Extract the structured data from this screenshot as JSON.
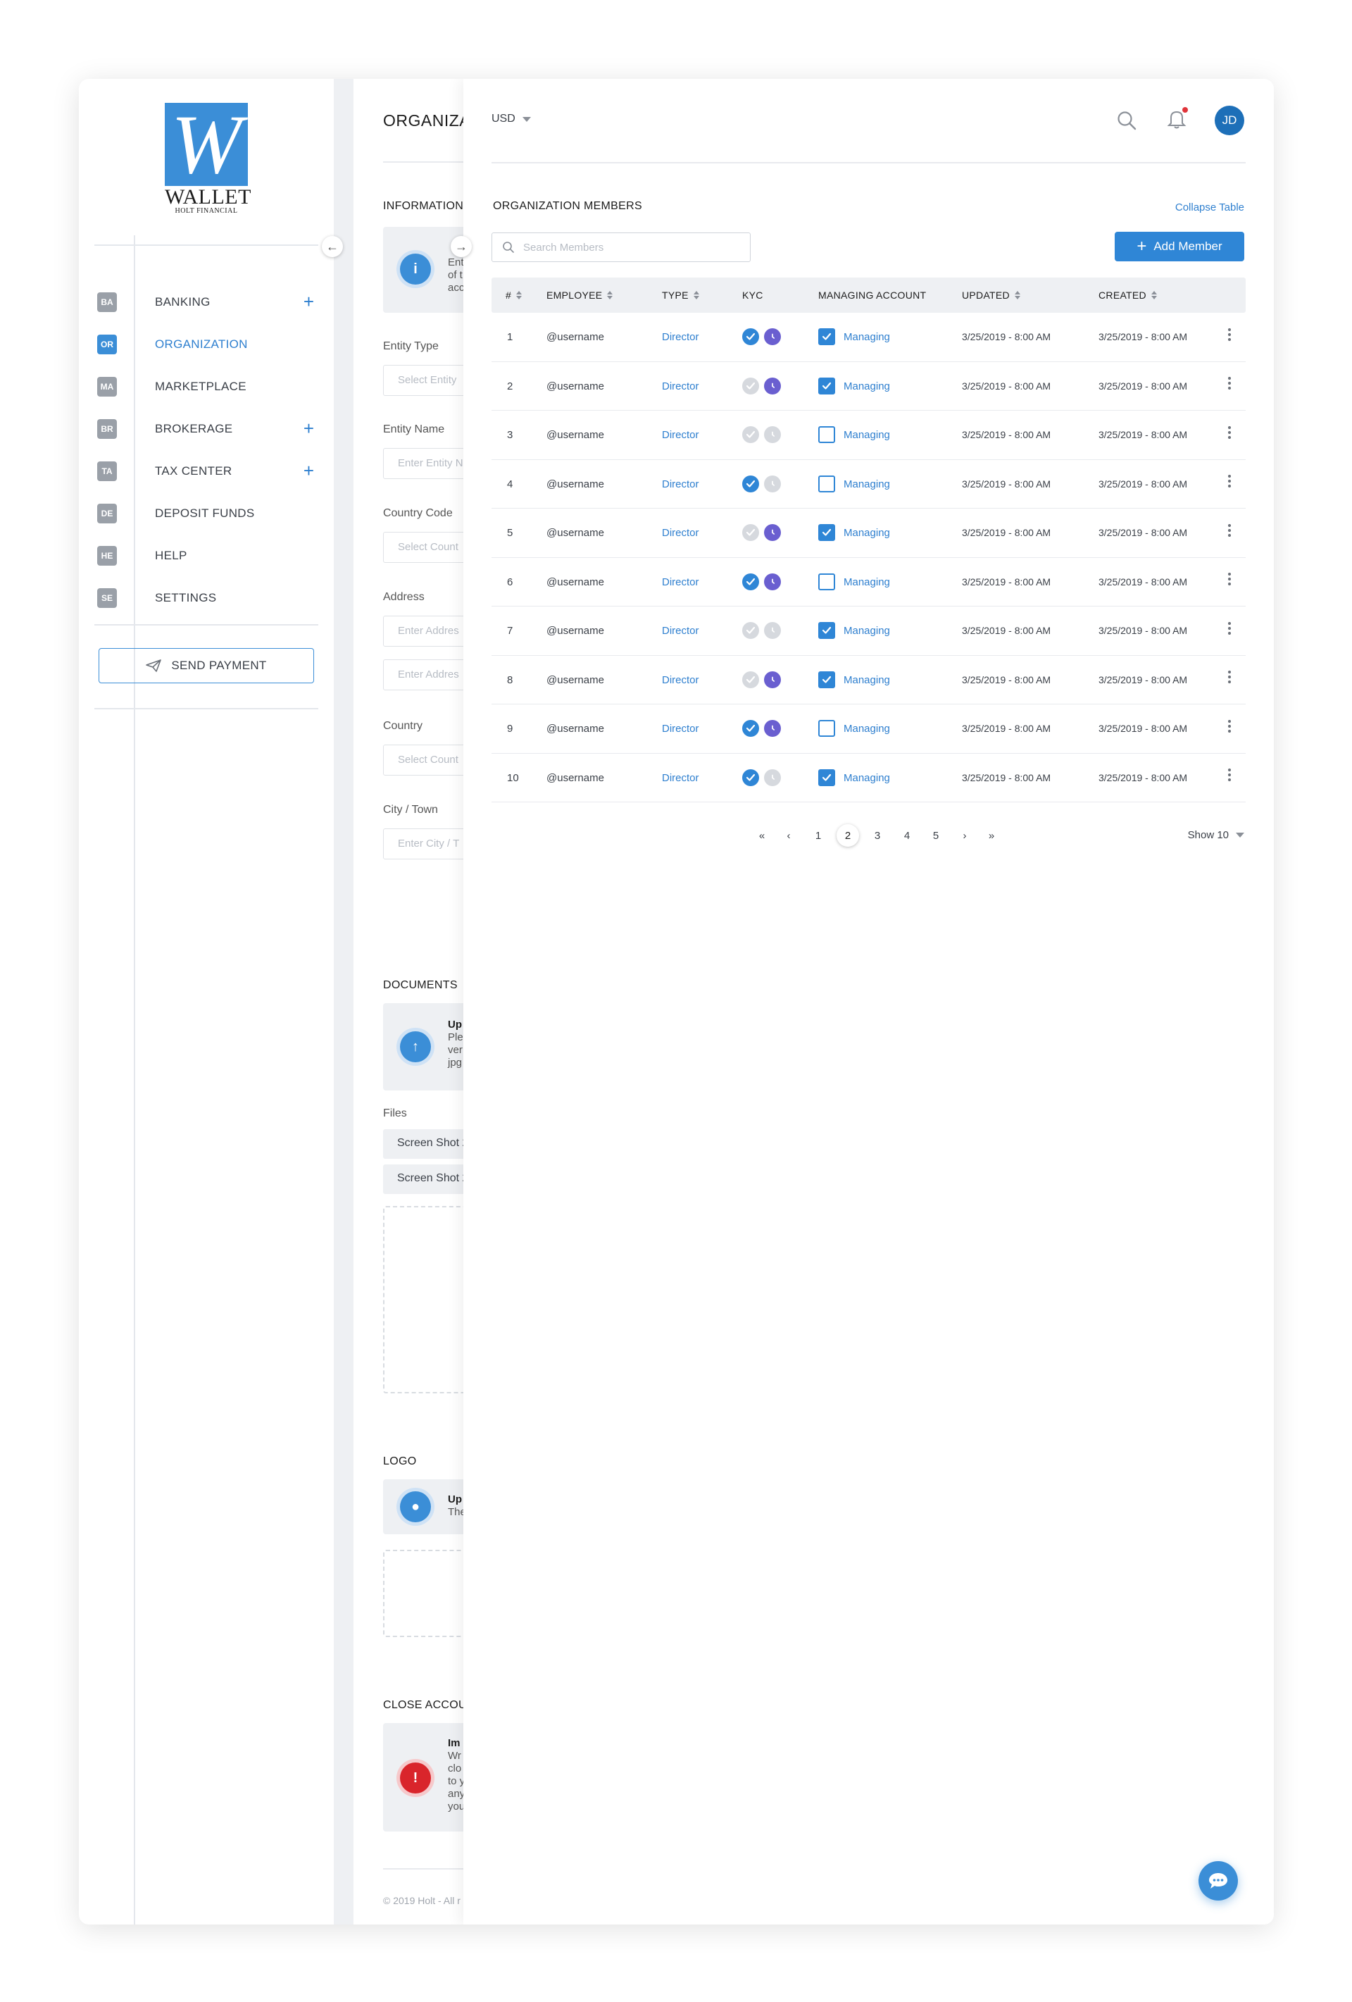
{
  "brand": {
    "name": "WALLET",
    "sub": "HOLT FINANCIAL",
    "monogram": "W"
  },
  "sidebar": {
    "items": [
      {
        "badge": "BA",
        "label": "BANKING",
        "has_plus": true,
        "active": false
      },
      {
        "badge": "OR",
        "label": "ORGANIZATION",
        "has_plus": false,
        "active": true
      },
      {
        "badge": "MA",
        "label": "MARKETPLACE",
        "has_plus": false,
        "active": false
      },
      {
        "badge": "BR",
        "label": "BROKERAGE",
        "has_plus": true,
        "active": false
      },
      {
        "badge": "TA",
        "label": "TAX CENTER",
        "has_plus": true,
        "active": false
      },
      {
        "badge": "DE",
        "label": "DEPOSIT FUNDS",
        "has_plus": false,
        "active": false
      },
      {
        "badge": "HE",
        "label": "HELP",
        "has_plus": false,
        "active": false
      },
      {
        "badge": "SE",
        "label": "SETTINGS",
        "has_plus": false,
        "active": false
      }
    ],
    "send_payment": "SEND PAYMENT"
  },
  "form": {
    "title": "ORGANIZA",
    "information_title": "INFORMATION",
    "info_text": [
      "Ent",
      "of t",
      "acc"
    ],
    "entity_type_label": "Entity Type",
    "entity_type_placeholder": "Select Entity",
    "entity_name_label": "Entity Name",
    "entity_name_placeholder": "Enter Entity N",
    "country_code_label": "Country Code",
    "country_code_placeholder": "Select Count",
    "address_label": "Address",
    "address_placeholder_1": "Enter Addres",
    "address_placeholder_2": "Enter Addres",
    "country_label": "Country",
    "country_placeholder": "Select Count",
    "city_label": "City / Town",
    "city_placeholder": "Enter City / T",
    "documents_title": "DOCUMENTS",
    "documents_text": [
      "Up",
      "Ple",
      "ver",
      "jpg"
    ],
    "files_label": "Files",
    "file_1": "Screen Shot 2",
    "file_2": "Screen Shot 2",
    "logo_title": "LOGO",
    "logo_text": [
      "Up",
      "The"
    ],
    "close_title": "CLOSE ACCOU",
    "close_text": [
      "Im",
      "Wr",
      "clo",
      "to y",
      "any",
      "you"
    ],
    "copyright": "© 2019 Holt - All r"
  },
  "header": {
    "currency": "USD",
    "avatar_initials": "JD",
    "has_notification": true
  },
  "members": {
    "title": "ORGANIZATION MEMBERS",
    "collapse_label": "Collapse Table",
    "search_placeholder": "Search Members",
    "add_label": "Add Member",
    "columns": [
      "#",
      "EMPLOYEE",
      "TYPE",
      "KYC",
      "MANAGING ACCOUNT",
      "UPDATED",
      "CREATED"
    ],
    "rows": [
      {
        "num": "1",
        "employee": "@username",
        "type": "Director",
        "kyc_verified": true,
        "kyc_pending": true,
        "managing": true,
        "managing_label": "Managing",
        "updated": "3/25/2019 - 8:00 AM",
        "created": "3/25/2019 - 8:00 AM"
      },
      {
        "num": "2",
        "employee": "@username",
        "type": "Director",
        "kyc_verified": false,
        "kyc_pending": true,
        "managing": true,
        "managing_label": "Managing",
        "updated": "3/25/2019 - 8:00 AM",
        "created": "3/25/2019 - 8:00 AM"
      },
      {
        "num": "3",
        "employee": "@username",
        "type": "Director",
        "kyc_verified": false,
        "kyc_pending": false,
        "managing": false,
        "managing_label": "Managing",
        "updated": "3/25/2019 - 8:00 AM",
        "created": "3/25/2019 - 8:00 AM"
      },
      {
        "num": "4",
        "employee": "@username",
        "type": "Director",
        "kyc_verified": true,
        "kyc_pending": false,
        "managing": false,
        "managing_label": "Managing",
        "updated": "3/25/2019 - 8:00 AM",
        "created": "3/25/2019 - 8:00 AM"
      },
      {
        "num": "5",
        "employee": "@username",
        "type": "Director",
        "kyc_verified": false,
        "kyc_pending": true,
        "managing": true,
        "managing_label": "Managing",
        "updated": "3/25/2019 - 8:00 AM",
        "created": "3/25/2019 - 8:00 AM"
      },
      {
        "num": "6",
        "employee": "@username",
        "type": "Director",
        "kyc_verified": true,
        "kyc_pending": true,
        "managing": false,
        "managing_label": "Managing",
        "updated": "3/25/2019 - 8:00 AM",
        "created": "3/25/2019 - 8:00 AM"
      },
      {
        "num": "7",
        "employee": "@username",
        "type": "Director",
        "kyc_verified": false,
        "kyc_pending": false,
        "managing": true,
        "managing_label": "Managing",
        "updated": "3/25/2019 - 8:00 AM",
        "created": "3/25/2019 - 8:00 AM"
      },
      {
        "num": "8",
        "employee": "@username",
        "type": "Director",
        "kyc_verified": false,
        "kyc_pending": true,
        "managing": true,
        "managing_label": "Managing",
        "updated": "3/25/2019 - 8:00 AM",
        "created": "3/25/2019 - 8:00 AM"
      },
      {
        "num": "9",
        "employee": "@username",
        "type": "Director",
        "kyc_verified": true,
        "kyc_pending": true,
        "managing": false,
        "managing_label": "Managing",
        "updated": "3/25/2019 - 8:00 AM",
        "created": "3/25/2019 - 8:00 AM"
      },
      {
        "num": "10",
        "employee": "@username",
        "type": "Director",
        "kyc_verified": true,
        "kyc_pending": false,
        "managing": true,
        "managing_label": "Managing",
        "updated": "3/25/2019 - 8:00 AM",
        "created": "3/25/2019 - 8:00 AM"
      }
    ],
    "pagination": {
      "pages": [
        "1",
        "2",
        "3",
        "4",
        "5"
      ],
      "current": "2",
      "show_label": "Show 10"
    }
  },
  "colors": {
    "accent": "#2f86d6",
    "brand": "#3b8ed7",
    "pending": "#6a5fd0",
    "alert": "#e0343a"
  }
}
